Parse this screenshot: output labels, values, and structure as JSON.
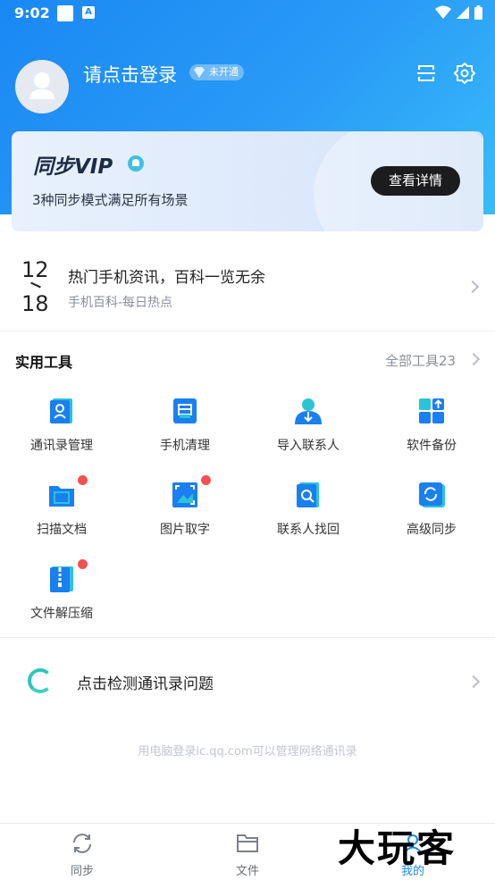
{
  "status_bar": {
    "time": "9:02",
    "notif_letter": "A"
  },
  "header": {
    "login_text": "请点击登录",
    "vip_status": "未开通"
  },
  "vip_card": {
    "title": "同步VIP",
    "subtitle": "3种同步模式满足所有场景",
    "button": "查看详情"
  },
  "news": {
    "date_top": "12",
    "date_bottom": "18",
    "title": "热门手机资讯，百科一览无余",
    "subtitle": "手机百科-每日热点"
  },
  "tools": {
    "title": "实用工具",
    "all_label": "全部工具23",
    "items": [
      {
        "label": "通讯录管理",
        "icon": "contacts-book-icon",
        "dot": false
      },
      {
        "label": "手机清理",
        "icon": "phone-clean-icon",
        "dot": false
      },
      {
        "label": "导入联系人",
        "icon": "import-contact-icon",
        "dot": false
      },
      {
        "label": "软件备份",
        "icon": "app-backup-icon",
        "dot": false
      },
      {
        "label": "扫描文档",
        "icon": "scan-document-icon",
        "dot": true
      },
      {
        "label": "图片取字",
        "icon": "image-text-icon",
        "dot": true
      },
      {
        "label": "联系人找回",
        "icon": "contact-recover-icon",
        "dot": false
      },
      {
        "label": "高级同步",
        "icon": "advanced-sync-icon",
        "dot": false
      },
      {
        "label": "文件解压缩",
        "icon": "file-unzip-icon",
        "dot": true
      }
    ]
  },
  "check": {
    "text": "点击检测通讯录问题"
  },
  "footer_note": "用电脑登录ic.qq.com可以管理网络通讯录",
  "tabs": [
    {
      "label": "同步",
      "icon": "sync-icon",
      "active": false
    },
    {
      "label": "文件",
      "icon": "folder-icon",
      "active": false
    },
    {
      "label": "我的",
      "icon": "profile-icon",
      "active": true
    }
  ],
  "watermark": "大玩客",
  "colors": {
    "accent": "#1a88f3",
    "active_tab": "#1a88f3",
    "red_dot": "#f05252"
  }
}
